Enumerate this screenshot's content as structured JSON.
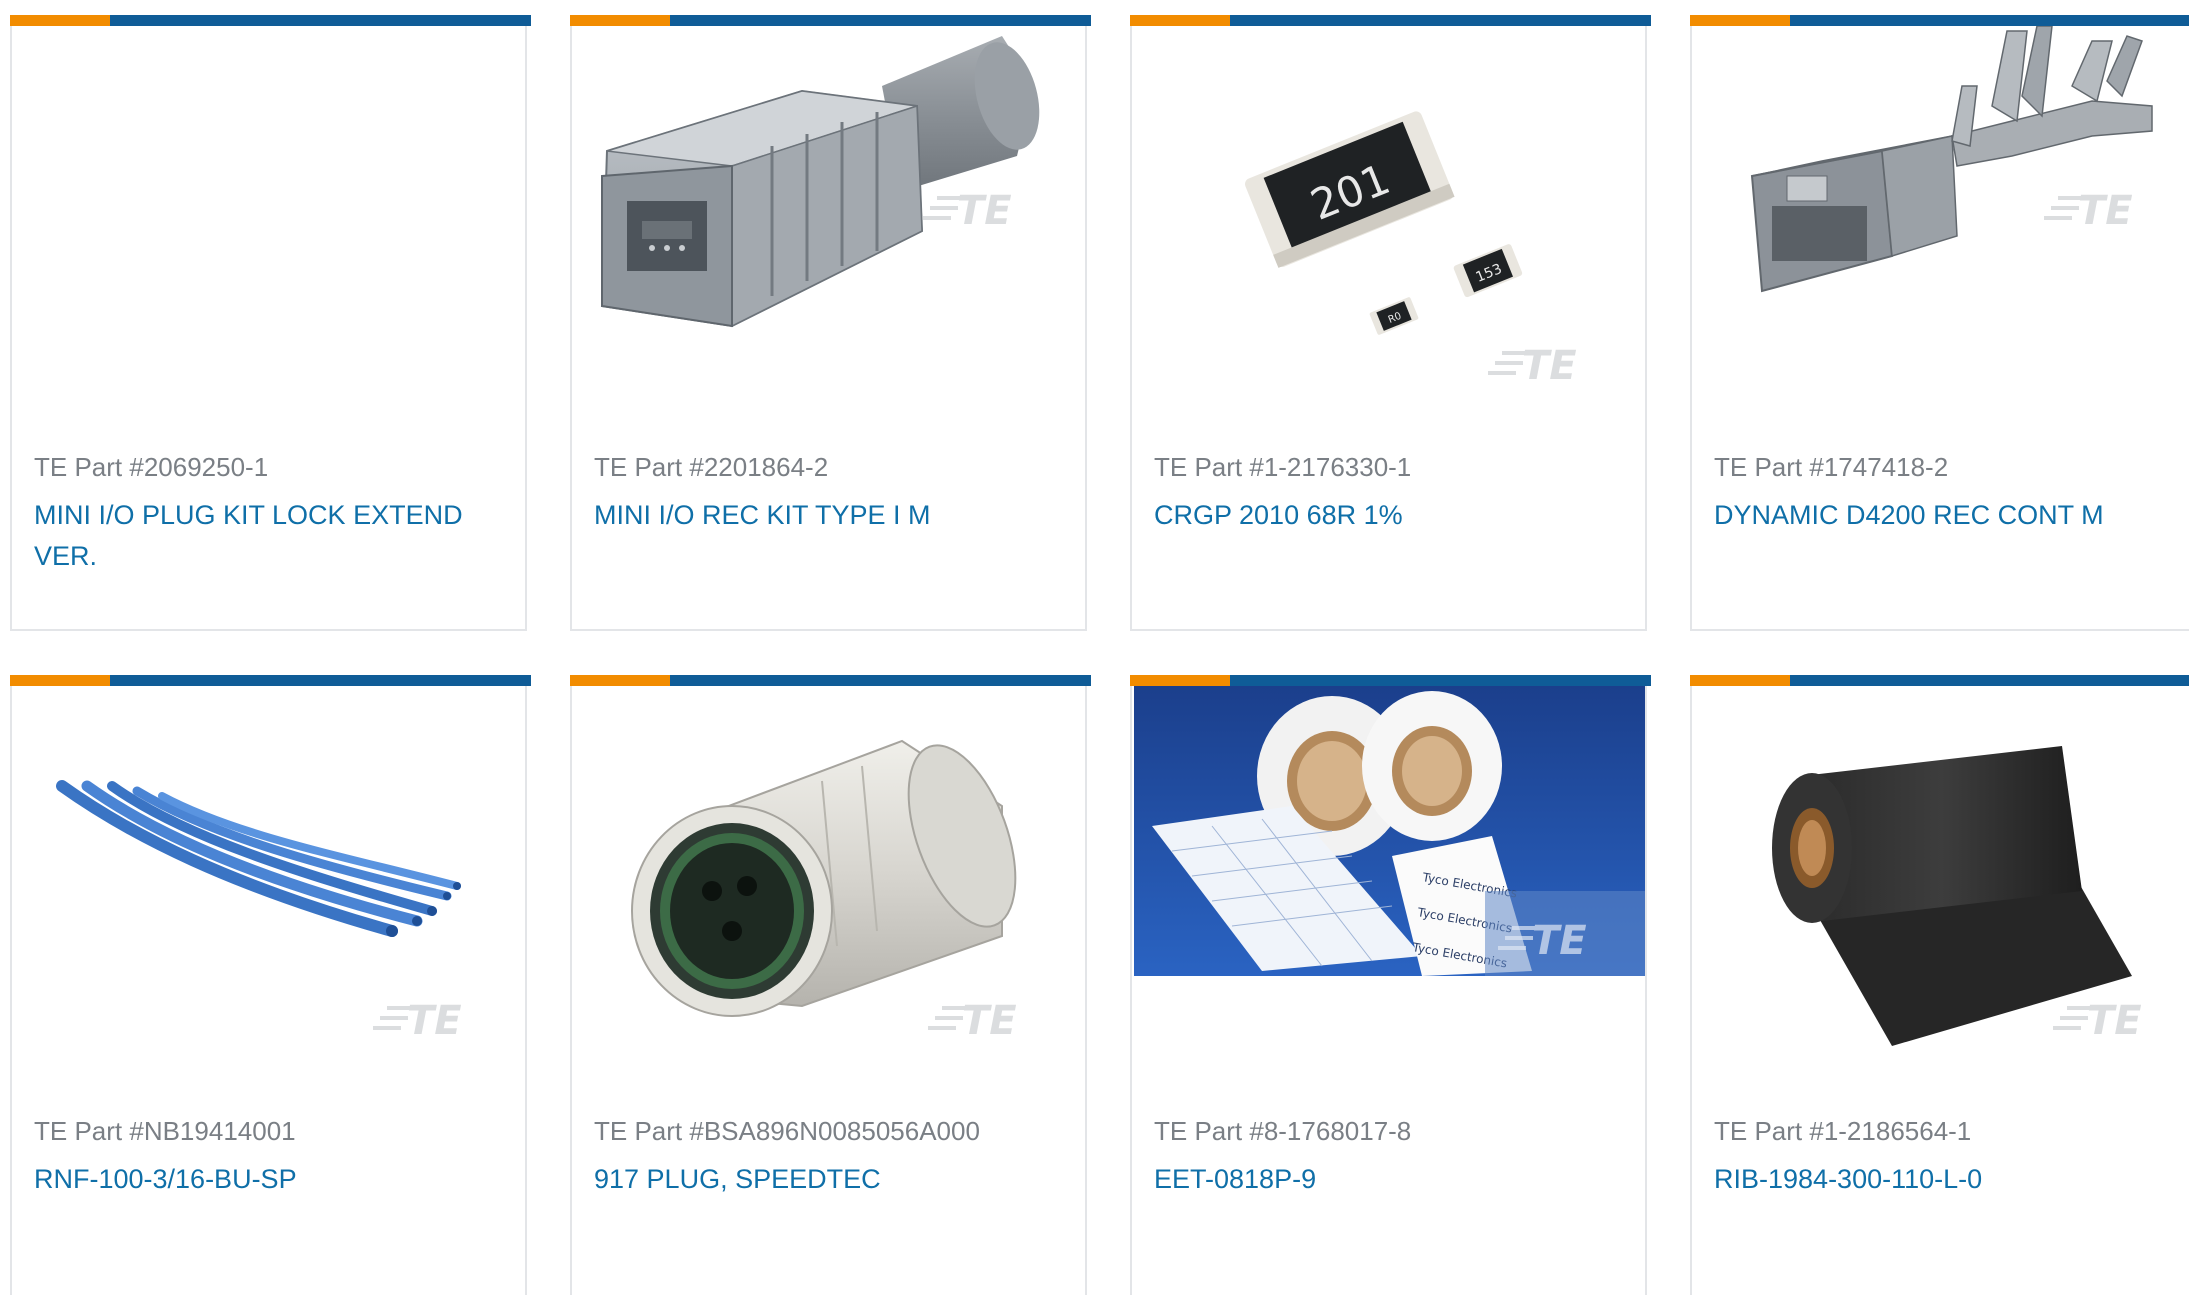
{
  "products": [
    {
      "part_label": "TE Part #2069250-1",
      "name": "MINI I/O PLUG KIT LOCK EXTEND VER.",
      "image_icon": "blank-image"
    },
    {
      "part_label": "TE Part #2201864-2",
      "name": "MINI I/O REC KIT TYPE I M",
      "image_icon": "connector-plug-image"
    },
    {
      "part_label": "TE Part #1-2176330-1",
      "name": "CRGP 2010 68R 1%",
      "image_icon": "resistor-chip-image",
      "image_text": [
        "201",
        "153",
        "R0"
      ]
    },
    {
      "part_label": "TE Part #1747418-2",
      "name": "DYNAMIC D4200 REC CONT M",
      "image_icon": "receptacle-contact-image"
    },
    {
      "part_label": "TE Part #NB19414001",
      "name": "RNF-100-3/16-BU-SP",
      "image_icon": "heat-shrink-tubing-image"
    },
    {
      "part_label": "TE Part #BSA896N0085056A000",
      "name": "917 PLUG, SPEEDTEC",
      "image_icon": "circular-connector-image"
    },
    {
      "part_label": "TE Part #8-1768017-8",
      "name": "EET-0818P-9",
      "image_icon": "label-rolls-image",
      "image_text": [
        "Tyco Electronics"
      ]
    },
    {
      "part_label": "TE Part #1-2186564-1",
      "name": "RIB-1984-300-110-L-0",
      "image_icon": "ribbon-roll-image"
    }
  ],
  "watermark": "TE",
  "colors": {
    "accent_orange": "#f28c00",
    "brand_blue": "#0f5c97",
    "link_blue": "#0f6fa8",
    "part_gray": "#7a7f85",
    "card_border": "#e3e5e8"
  }
}
